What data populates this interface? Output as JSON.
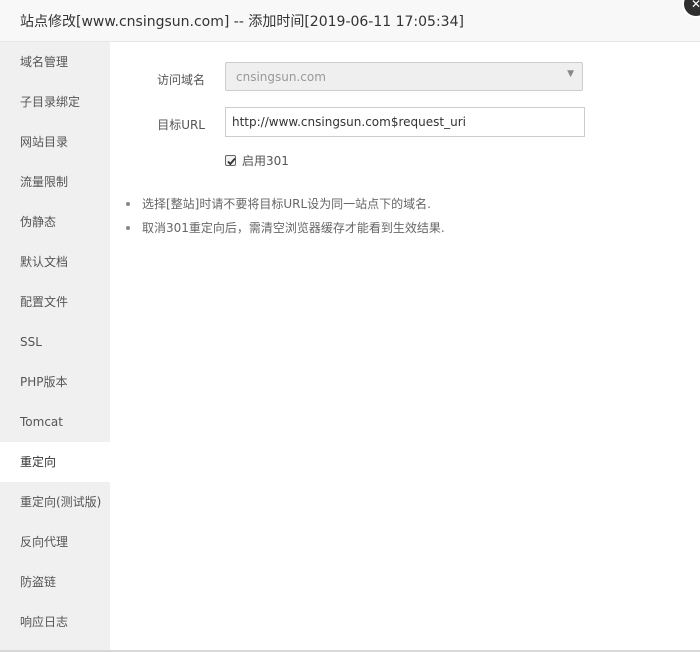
{
  "dialog": {
    "title": "站点修改[www.cnsingsun.com] -- 添加时间[2019-06-11 17:05:34]",
    "close_icon": "close-icon"
  },
  "sidebar": {
    "items": [
      {
        "label": "域名管理",
        "active": false
      },
      {
        "label": "子目录绑定",
        "active": false
      },
      {
        "label": "网站目录",
        "active": false
      },
      {
        "label": "流量限制",
        "active": false
      },
      {
        "label": "伪静态",
        "active": false
      },
      {
        "label": "默认文档",
        "active": false
      },
      {
        "label": "配置文件",
        "active": false
      },
      {
        "label": "SSL",
        "active": false
      },
      {
        "label": "PHP版本",
        "active": false
      },
      {
        "label": "Tomcat",
        "active": false
      },
      {
        "label": "重定向",
        "active": true
      },
      {
        "label": "重定向(测试版)",
        "active": false
      },
      {
        "label": "反向代理",
        "active": false
      },
      {
        "label": "防盗链",
        "active": false
      },
      {
        "label": "响应日志",
        "active": false
      }
    ]
  },
  "form": {
    "domain_label": "访问域名",
    "domain_value": "cnsingsun.com",
    "target_label": "目标URL",
    "target_value": "http://www.cnsingsun.com$request_uri",
    "enable_label": "启用301",
    "enable_checked": true
  },
  "tips": [
    "选择[整站]时请不要将目标URL设为同一站点下的域名.",
    "取消301重定向后，需清空浏览器缓存才能看到生效结果."
  ]
}
